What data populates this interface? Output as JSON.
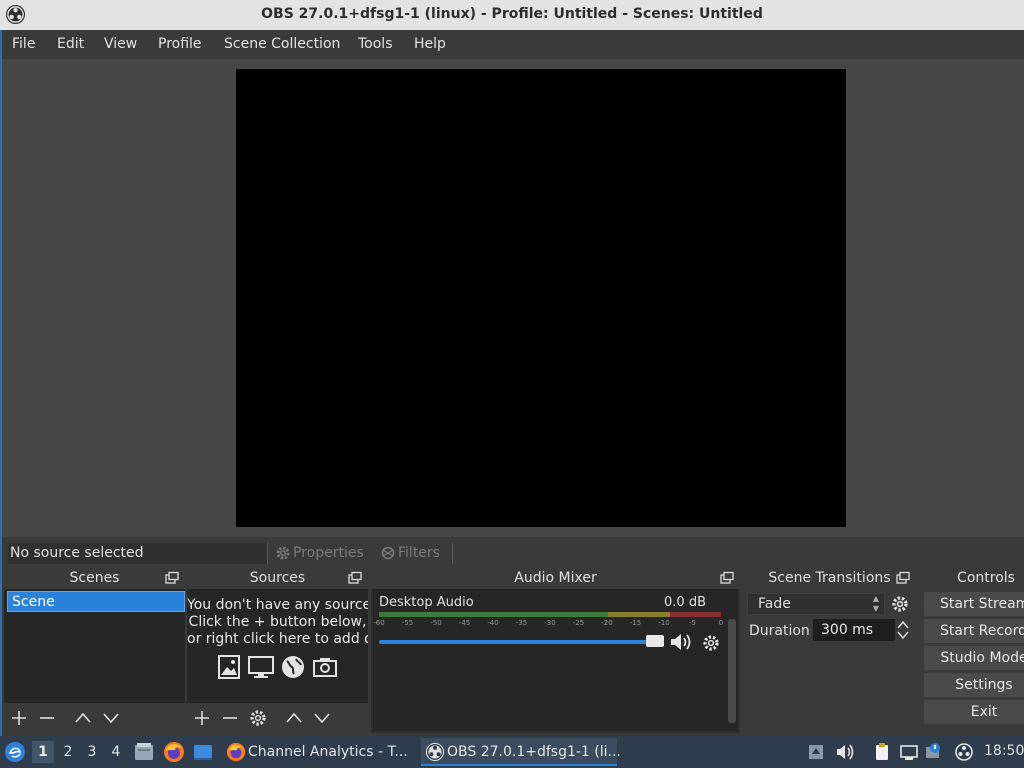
{
  "window": {
    "title": "OBS 27.0.1+dfsg1-1 (linux) - Profile: Untitled - Scenes: Untitled"
  },
  "menu": [
    "File",
    "Edit",
    "View",
    "Profile",
    "Scene Collection",
    "Tools",
    "Help"
  ],
  "source_bar": {
    "status": "No source selected",
    "properties_label": "Properties",
    "filters_label": "Filters"
  },
  "docks": {
    "scenes": {
      "title": "Scenes",
      "items": [
        "Scene"
      ]
    },
    "sources": {
      "title": "Sources",
      "hint_lines": [
        "You don't have any sources.",
        "Click the + button below,",
        "or right click here to add one."
      ]
    },
    "mixer": {
      "title": "Audio Mixer",
      "channel_name": "Desktop Audio",
      "channel_db": "0.0 dB",
      "ticks": [
        "-60",
        "-55",
        "-50",
        "-45",
        "-40",
        "-35",
        "-30",
        "-25",
        "-20",
        "-15",
        "-10",
        "-5",
        "0"
      ],
      "volume_fraction": 1.0
    },
    "transitions": {
      "title": "Scene Transitions",
      "selected": "Fade",
      "duration_label": "Duration",
      "duration_value": "300 ms"
    },
    "controls": {
      "title": "Controls",
      "buttons": [
        "Start Streaming",
        "Start Recording",
        "Studio Mode",
        "Settings",
        "Exit"
      ]
    }
  },
  "taskbar": {
    "workspaces": [
      "1",
      "2",
      "3",
      "4"
    ],
    "active_workspace": "1",
    "windows": [
      "Channel Analytics - T...",
      "OBS 27.0.1+dfsg1-1 (li..."
    ],
    "clock": "18:50"
  },
  "colors": {
    "accent": "#2a82da",
    "meter_green": "#3e7a3e",
    "meter_yellow": "#8a7f30",
    "meter_red": "#8a2f2f"
  }
}
